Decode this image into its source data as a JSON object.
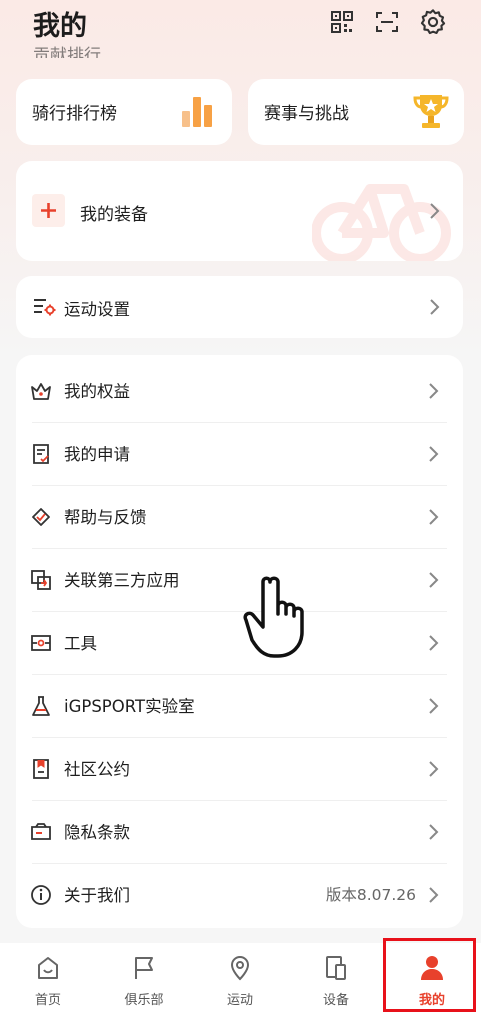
{
  "header": {
    "title": "我的",
    "partial_text": "贡献排行"
  },
  "quick_cards": [
    {
      "label": "骑行排行榜",
      "icon": "bar-chart-icon"
    },
    {
      "label": "赛事与挑战",
      "icon": "trophy-icon"
    }
  ],
  "equipment": {
    "label": "我的装备",
    "icon": "plus-icon"
  },
  "sport_settings": {
    "label": "运动设置",
    "icon": "settings-list-icon"
  },
  "menu": [
    {
      "label": "我的权益",
      "icon": "crown-icon"
    },
    {
      "label": "我的申请",
      "icon": "application-doc-icon"
    },
    {
      "label": "帮助与反馈",
      "icon": "help-feedback-icon"
    },
    {
      "label": "关联第三方应用",
      "icon": "link-app-icon"
    },
    {
      "label": "工具",
      "icon": "toolbox-icon"
    },
    {
      "label": "iGPSPORT实验室",
      "icon": "flask-icon"
    },
    {
      "label": "社区公约",
      "icon": "community-rules-icon"
    },
    {
      "label": "隐私条款",
      "icon": "privacy-icon"
    },
    {
      "label": "关于我们",
      "icon": "info-icon",
      "value": "版本8.07.26"
    }
  ],
  "nav": [
    {
      "label": "首页",
      "icon": "home-icon"
    },
    {
      "label": "俱乐部",
      "icon": "flag-icon"
    },
    {
      "label": "运动",
      "icon": "location-pin-icon"
    },
    {
      "label": "设备",
      "icon": "devices-icon"
    },
    {
      "label": "我的",
      "icon": "person-icon",
      "active": true
    }
  ],
  "colors": {
    "accent": "#e8412c",
    "highlight_box": "#e8111a",
    "gold": "#f5b62a",
    "orange": "#f7a145"
  }
}
